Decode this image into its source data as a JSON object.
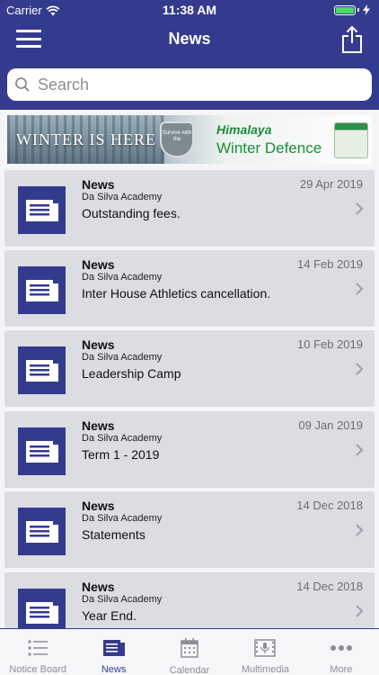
{
  "status": {
    "carrier": "Carrier",
    "time": "11:38 AM"
  },
  "nav": {
    "title": "News"
  },
  "search": {
    "placeholder": "Search",
    "value": ""
  },
  "banner": {
    "winter_text": "WINTER IS HERE",
    "badge_text": "Survive with the",
    "brand": "Himalaya",
    "product_line": "Winter Defence"
  },
  "news": [
    {
      "type": "News",
      "org": "Da Silva Academy",
      "headline": "Outstanding fees.",
      "date": "29 Apr 2019"
    },
    {
      "type": "News",
      "org": "Da Silva Academy",
      "headline": "Inter House Athletics cancellation.",
      "date": "14 Feb 2019"
    },
    {
      "type": "News",
      "org": "Da Silva Academy",
      "headline": "Leadership Camp",
      "date": "10 Feb 2019"
    },
    {
      "type": "News",
      "org": "Da Silva Academy",
      "headline": "Term 1 - 2019",
      "date": "09 Jan 2019"
    },
    {
      "type": "News",
      "org": "Da Silva Academy",
      "headline": "Statements",
      "date": "14 Dec 2018"
    },
    {
      "type": "News",
      "org": "Da Silva Academy",
      "headline": "Year End.",
      "date": "14 Dec 2018"
    }
  ],
  "tabs": [
    {
      "label": "Notice Board",
      "icon": "list-icon",
      "active": false
    },
    {
      "label": "News",
      "icon": "newspaper-icon",
      "active": true
    },
    {
      "label": "Calendar",
      "icon": "calendar-icon",
      "active": false
    },
    {
      "label": "Multimedia",
      "icon": "microphone-icon",
      "active": false
    },
    {
      "label": "More",
      "icon": "more-dots-icon",
      "active": false
    }
  ],
  "colors": {
    "primary": "#343b8f",
    "card_bg": "#dcdce3",
    "battery": "#4cd964"
  }
}
